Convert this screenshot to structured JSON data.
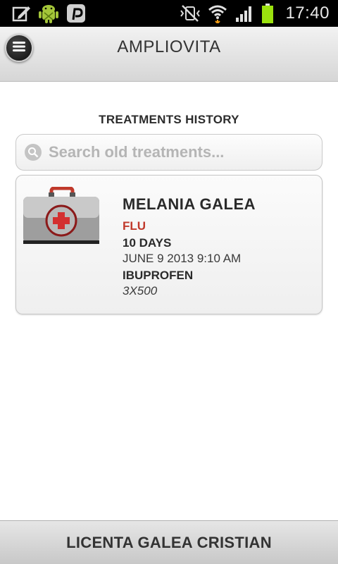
{
  "status_bar": {
    "time": "17:40",
    "left_icons": [
      "edit-icon",
      "android-debug-icon",
      "pinterest-icon"
    ],
    "right_icons": [
      "vibrate-silent-icon",
      "wifi-icon",
      "signal-icon",
      "battery-icon"
    ],
    "battery_color": "#9be20e"
  },
  "action_bar": {
    "title": "AMPLIOVITA",
    "menu_icon": "menu-icon"
  },
  "main": {
    "section_title": "TREATMENTS HISTORY",
    "search": {
      "placeholder": "Search old treatments...",
      "value": "",
      "icon": "search-icon"
    },
    "treatments": [
      {
        "icon": "medical-kit-icon",
        "patient_name": "MELANIA GALEA",
        "diagnosis": "FLU",
        "duration": "10 DAYS",
        "date": "JUNE 9 2013 9:10 AM",
        "medicine": "IBUPROFEN",
        "dosage": "3X500"
      }
    ]
  },
  "footer": {
    "text": "LICENTA GALEA CRISTIAN"
  },
  "colors": {
    "diagnosis": "#c0392b",
    "status_bar": "#000000"
  }
}
